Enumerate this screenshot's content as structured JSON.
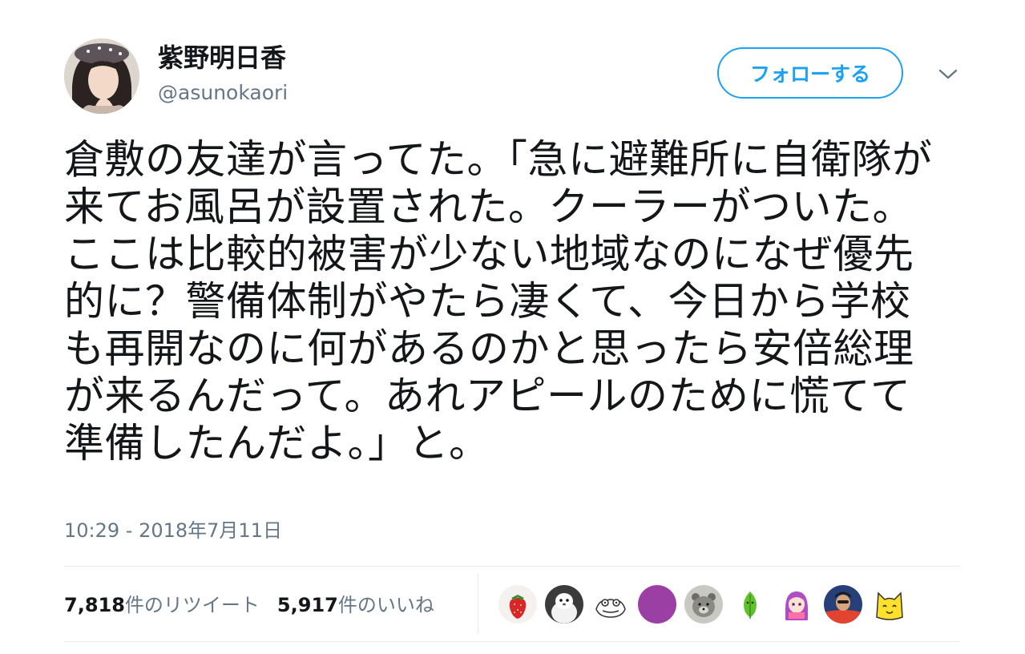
{
  "tweet": {
    "author": {
      "display_name": "紫野明日香",
      "handle": "@asunokaori",
      "avatar": "user-portrait-avatar"
    },
    "follow_label": "フォローする",
    "menu_icon": "chevron-down-icon",
    "text": "倉敷の友達が言ってた。「急に避難所に自衛隊が来てお風呂が設置された。クーラーがついた。ここは比較的被害が少ない地域なのになぜ優先的に？警備体制がやたら凄くて、今日から学校も再開なのに何があるのかと思ったら安倍総理が来るんだって。あれアピールのために慌てて準備したんだよ。」と。",
    "timestamp": "10:29 - 2018年7月11日",
    "retweets": {
      "count": "7,818",
      "label": "件のリツイート"
    },
    "likes": {
      "count": "5,917",
      "label": "件のいいね"
    },
    "likers": [
      "strawberry-avatar",
      "white-ferret-avatar",
      "frog-sketch-avatar",
      "purple-circle-avatar",
      "bear-avatar",
      "green-leaf-avatar",
      "anime-girl-avatar",
      "person-avatar",
      "yellow-cat-avatar"
    ]
  },
  "colors": {
    "accent": "#1da1f2",
    "text_primary": "#14171a",
    "text_secondary": "#657786",
    "divider": "#e6ecf0"
  }
}
